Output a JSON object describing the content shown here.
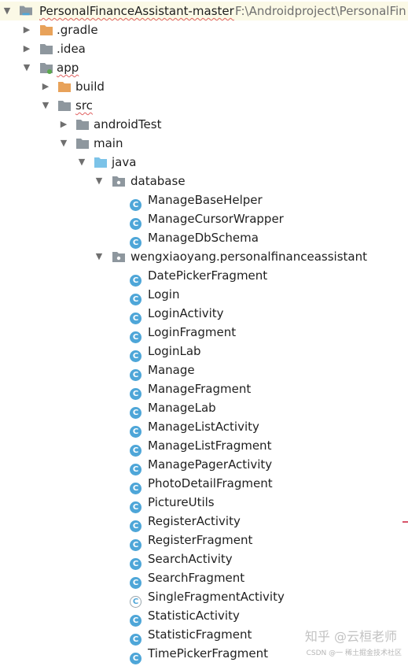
{
  "project": {
    "name": "PersonalFinanceAssistant-master",
    "path": "F:\\Androidproject\\PersonalFin"
  },
  "folders": {
    "gradle": ".gradle",
    "idea": ".idea",
    "app": "app",
    "build": "build",
    "src": "src",
    "androidTest": "androidTest",
    "main": "main",
    "java": "java",
    "database": "database",
    "package": "wengxiaoyang.personalfinanceassistant"
  },
  "database_classes": [
    "ManageBaseHelper",
    "ManageCursorWrapper",
    "ManageDbSchema"
  ],
  "package_classes": [
    "DatePickerFragment",
    "Login",
    "LoginActivity",
    "LoginFragment",
    "LoginLab",
    "Manage",
    "ManageFragment",
    "ManageLab",
    "ManageListActivity",
    "ManageListFragment",
    "ManagePagerActivity",
    "PhotoDetailFragment",
    "PictureUtils",
    "RegisterActivity",
    "RegisterFragment",
    "SearchActivity",
    "SearchFragment",
    "SingleFragmentActivity",
    "StatisticActivity",
    "StatisticFragment",
    "TimePickerFragment"
  ],
  "class_icon_letter": "C",
  "watermark": {
    "main": "知乎 @云桓老师",
    "sub": "CSDN @一 稀土掘金技术社区"
  },
  "colors": {
    "class_icon": "#4ea6d8",
    "folder_grey": "#8e979e",
    "folder_orange": "#e8a25a",
    "folder_blue": "#7cc3e8",
    "selected_row": "#fbf9e6",
    "squiggle": "#e06060"
  }
}
